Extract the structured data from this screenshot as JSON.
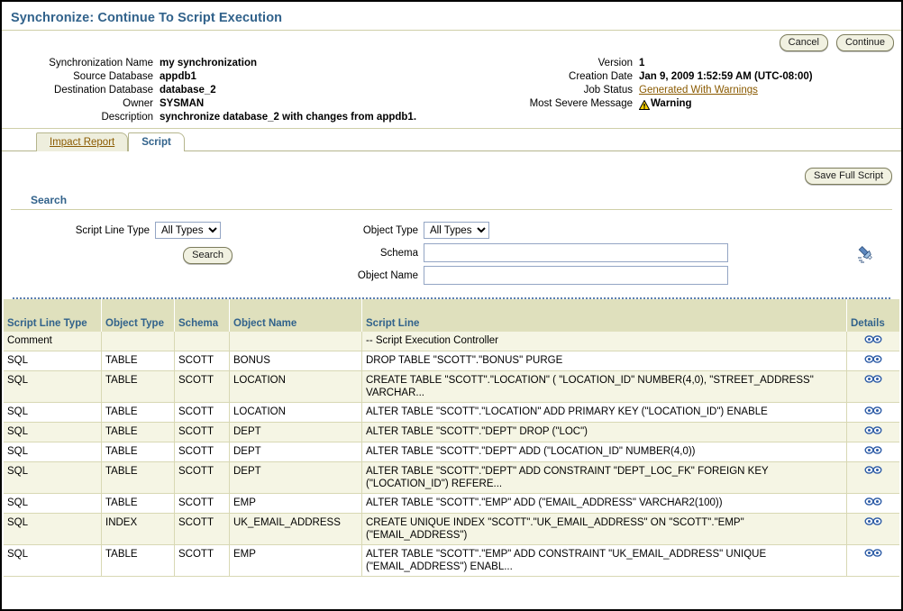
{
  "page": {
    "title": "Synchronize: Continue To Script Execution"
  },
  "actions": {
    "cancel_label": "Cancel",
    "continue_label": "Continue",
    "save_full_script_label": "Save Full Script"
  },
  "summary": {
    "left": [
      {
        "label": "Synchronization Name",
        "value": "my synchronization"
      },
      {
        "label": "Source Database",
        "value": "appdb1"
      },
      {
        "label": "Destination Database",
        "value": "database_2"
      },
      {
        "label": "Owner",
        "value": "SYSMAN"
      }
    ],
    "description": {
      "label": "Description",
      "value": "synchronize database_2 with changes from appdb1."
    },
    "right": [
      {
        "label": "Version",
        "value": "1"
      },
      {
        "label": "Creation Date",
        "value": "Jan 9, 2009 1:52:59 AM (UTC-08:00)"
      }
    ],
    "job_status": {
      "label": "Job Status",
      "value": "Generated With Warnings"
    },
    "most_severe": {
      "label": "Most Severe Message",
      "value": "Warning",
      "icon": "warning-icon"
    }
  },
  "tabs": [
    {
      "label": "Impact Report",
      "active": false
    },
    {
      "label": "Script",
      "active": true
    }
  ],
  "search": {
    "heading": "Search",
    "script_line_type": {
      "label": "Script Line Type",
      "value": "All Types",
      "options": [
        "All Types"
      ]
    },
    "object_type": {
      "label": "Object Type",
      "value": "All Types",
      "options": [
        "All Types"
      ]
    },
    "schema": {
      "label": "Schema",
      "value": "",
      "placeholder": ""
    },
    "object_name": {
      "label": "Object Name",
      "value": "",
      "placeholder": ""
    },
    "search_button_label": "Search",
    "torch_icon": "flashlight-icon"
  },
  "table": {
    "columns": [
      "Script Line Type",
      "Object Type",
      "Schema",
      "Object Name",
      "Script Line",
      "Details"
    ],
    "details_icon": "binoculars-icon",
    "rows": [
      {
        "script_line_type": "Comment",
        "object_type": "",
        "schema": "",
        "object_name": "",
        "script_line": "-- Script Execution Controller"
      },
      {
        "script_line_type": "SQL",
        "object_type": "TABLE",
        "schema": "SCOTT",
        "object_name": "BONUS",
        "script_line": "DROP TABLE \"SCOTT\".\"BONUS\" PURGE"
      },
      {
        "script_line_type": "SQL",
        "object_type": "TABLE",
        "schema": "SCOTT",
        "object_name": "LOCATION",
        "script_line": "CREATE TABLE \"SCOTT\".\"LOCATION\" ( \"LOCATION_ID\" NUMBER(4,0), \"STREET_ADDRESS\" VARCHAR..."
      },
      {
        "script_line_type": "SQL",
        "object_type": "TABLE",
        "schema": "SCOTT",
        "object_name": "LOCATION",
        "script_line": "ALTER TABLE \"SCOTT\".\"LOCATION\" ADD PRIMARY KEY (\"LOCATION_ID\") ENABLE"
      },
      {
        "script_line_type": "SQL",
        "object_type": "TABLE",
        "schema": "SCOTT",
        "object_name": "DEPT",
        "script_line": "ALTER TABLE \"SCOTT\".\"DEPT\" DROP (\"LOC\")"
      },
      {
        "script_line_type": "SQL",
        "object_type": "TABLE",
        "schema": "SCOTT",
        "object_name": "DEPT",
        "script_line": "ALTER TABLE \"SCOTT\".\"DEPT\" ADD (\"LOCATION_ID\" NUMBER(4,0))"
      },
      {
        "script_line_type": "SQL",
        "object_type": "TABLE",
        "schema": "SCOTT",
        "object_name": "DEPT",
        "script_line": "ALTER TABLE \"SCOTT\".\"DEPT\" ADD CONSTRAINT \"DEPT_LOC_FK\" FOREIGN KEY (\"LOCATION_ID\") REFERE..."
      },
      {
        "script_line_type": "SQL",
        "object_type": "TABLE",
        "schema": "SCOTT",
        "object_name": "EMP",
        "script_line": "ALTER TABLE \"SCOTT\".\"EMP\" ADD (\"EMAIL_ADDRESS\" VARCHAR2(100))"
      },
      {
        "script_line_type": "SQL",
        "object_type": "INDEX",
        "schema": "SCOTT",
        "object_name": "UK_EMAIL_ADDRESS",
        "script_line": "CREATE UNIQUE INDEX \"SCOTT\".\"UK_EMAIL_ADDRESS\" ON \"SCOTT\".\"EMP\" (\"EMAIL_ADDRESS\")"
      },
      {
        "script_line_type": "SQL",
        "object_type": "TABLE",
        "schema": "SCOTT",
        "object_name": "EMP",
        "script_line": "ALTER TABLE \"SCOTT\".\"EMP\" ADD CONSTRAINT \"UK_EMAIL_ADDRESS\" UNIQUE (\"EMAIL_ADDRESS\") ENABL..."
      }
    ]
  },
  "colors": {
    "title_blue": "#31628b",
    "link_brown": "#8a5a00",
    "table_header_bg": "#dfe0bd",
    "alt_row_bg": "#f5f5e4",
    "rule_olive": "#cfcfa8",
    "dotted_blue": "#5b7fb0",
    "warning_yellow": "#ffd700"
  }
}
